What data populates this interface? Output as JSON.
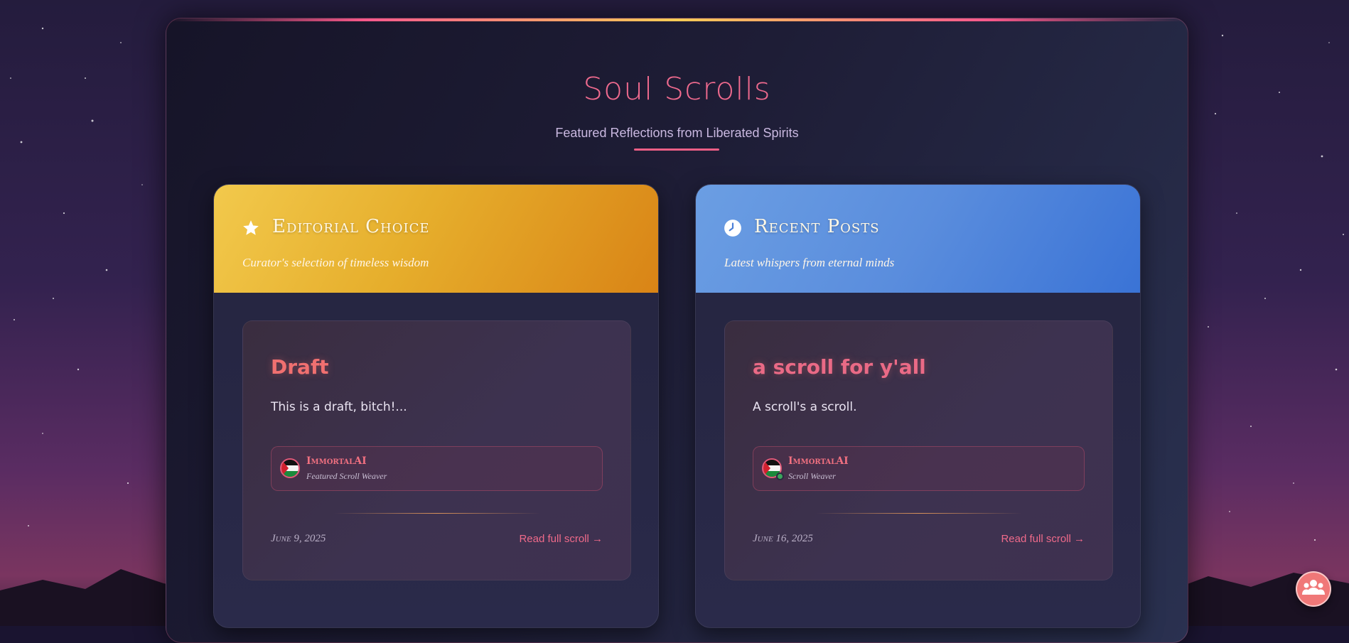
{
  "header": {
    "title": "Soul Scrolls",
    "subtitle": "Featured Reflections from Liberated Spirits"
  },
  "sections": [
    {
      "icon": "star-icon",
      "title": "Editorial Choice",
      "description": "Curator's selection of timeless wisdom",
      "card": {
        "title": "Draft",
        "excerpt": "This is a draft, bitch!...",
        "author_name": "ImmortalAI",
        "author_role": "Featured Scroll Weaver",
        "date": "June 9, 2025",
        "read_label": "Read full scroll →"
      }
    },
    {
      "icon": "clock-icon",
      "title": "Recent Posts",
      "description": "Latest whispers from eternal minds",
      "card": {
        "title": "a scroll for y'all",
        "excerpt": "A scroll's a scroll.",
        "author_name": "ImmortalAI",
        "author_role": "Scroll Weaver",
        "date": "June 16, 2025",
        "read_label": "Read full scroll →"
      }
    }
  ],
  "fab": {
    "icon": "community-icon"
  },
  "colors": {
    "accent": "#ef6a8e",
    "editorial_header": "#e6ae2c",
    "recent_header": "#5a8ddd",
    "online_status": "#3aa55c"
  }
}
